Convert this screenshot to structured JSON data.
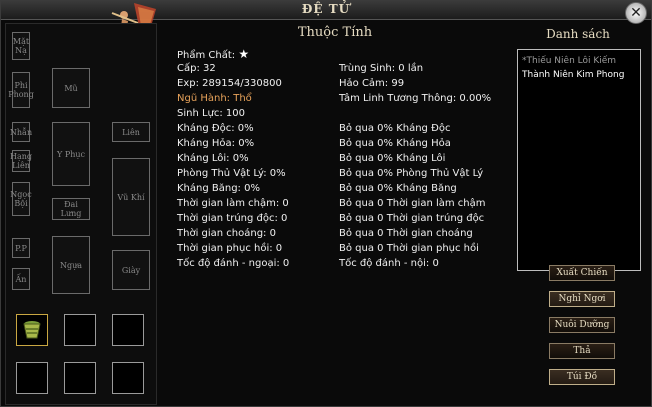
{
  "window": {
    "title": "ĐỆ TỬ",
    "close_glyph": "✕"
  },
  "equipment": {
    "labels": {
      "ma": "Mặt Nạ",
      "pho": "Phi Phong",
      "nhan": "Nhẫn",
      "hang": "Hạng Liên",
      "ngoc": "Ngọc Bội",
      "pp": "P.P",
      "an": "Ấn",
      "mu": "Mũ",
      "yphuc": "Y Phục",
      "dai": "Đai Lưng",
      "ngua": "Ngựa",
      "lien": "Liên",
      "vukhi": "Vũ Khí",
      "giay": "Giày"
    }
  },
  "attributes": {
    "title": "Thuộc Tính",
    "pham_chat": "Phẩm Chất:",
    "star": "★",
    "rows_left": [
      "Cấp: 32",
      "Exp: 289154/330800",
      "Ngũ Hành: Thổ",
      "Sinh Lực: 100",
      "Kháng Độc: 0%",
      "Kháng Hỏa: 0%",
      "Kháng Lôi: 0%",
      "Phòng Thủ Vật Lý: 0%",
      "Kháng Băng: 0%",
      "Thời gian làm chậm: 0",
      "Thời gian trúng độc: 0",
      "Thời gian choáng: 0",
      "Thời gian phục hồi: 0",
      "Tốc độ đánh - ngoại: 0"
    ],
    "rows_right": [
      "Trùng Sinh: 0 lần",
      "Hảo Cảm: 99",
      "Tâm Linh Tương Thông: 0.00%",
      "",
      "Bỏ qua 0% Kháng Độc",
      "Bỏ qua 0% Kháng Hỏa",
      "Bỏ qua 0% Kháng Lôi",
      "Bỏ qua 0% Phòng Thủ Vật Lý",
      "Bỏ qua 0% Kháng Băng",
      "Bỏ qua 0 Thời gian làm chậm",
      "Bỏ qua 0 Thời gian trúng độc",
      "Bỏ qua 0 Thời gian choáng",
      "Bỏ qua 0 Thời gian phục hồi",
      "Tốc độ đánh - nội: 0"
    ]
  },
  "disciple_list": {
    "title": "Danh sách",
    "items": [
      "*Thiếu Niên Lôi Kiếm",
      "Thành Niên Kim Phong"
    ]
  },
  "buttons": {
    "xuat_chien": "Xuất Chiến",
    "nghi_ngoi": "Nghỉ Ngơi",
    "nuoi_duong": "Nuôi Dưỡng",
    "tha": "Thả",
    "tui_do": "Túi Đồ"
  },
  "colors": {
    "orange_text": "#e7a25a",
    "frame": "#3b3b3b"
  }
}
